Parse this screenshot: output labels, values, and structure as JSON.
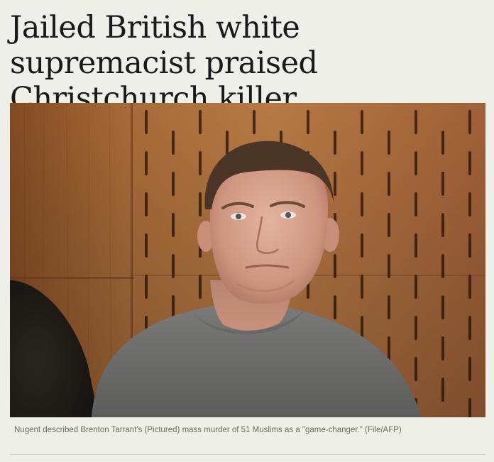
{
  "article": {
    "headline": "Jailed British white supremacist praised Christchurch killer",
    "caption": "Nugent described Brenton Tarrant's (Pictured) mass murder of 51 Muslims as a \"game-changer.\" (File/AFP)"
  },
  "colors": {
    "background": "#eeefe9",
    "headline": "#1a1a1a",
    "caption": "#6b6b66",
    "wood": "#b5733c",
    "sweater": "#6d6e6c"
  }
}
